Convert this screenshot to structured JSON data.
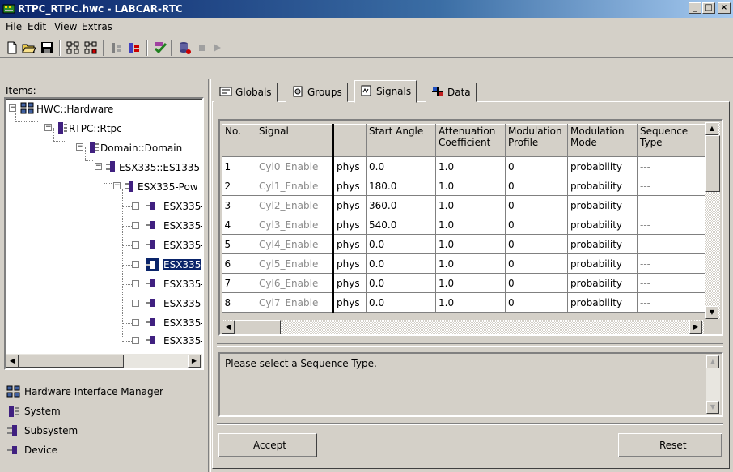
{
  "window": {
    "title": "RTPC_RTPC.hwc - LABCAR-RTC",
    "controls": [
      "_",
      "□",
      "×"
    ]
  },
  "menu": [
    {
      "label": "File"
    },
    {
      "label": "Edit"
    },
    {
      "label": "View"
    },
    {
      "label": "Extras"
    }
  ],
  "toolbar": {
    "icons": [
      "new-icon",
      "open-icon",
      "save-icon",
      "hardware-icon",
      "hardware-alt-icon",
      "config-icon",
      "config-alt-icon",
      "check-icon",
      "database-icon",
      "stop-icon",
      "play-icon"
    ]
  },
  "left": {
    "items_label": "Items:",
    "tree": [
      {
        "label": "HWC::Hardware",
        "level": 0,
        "expander": "−",
        "icon": "hardware"
      },
      {
        "label": "RTPC::Rtpc",
        "level": 1,
        "expander": "−",
        "icon": "system"
      },
      {
        "label": "Domain::Domain",
        "level": 2,
        "expander": "−",
        "icon": "system"
      },
      {
        "label": "ESX335::ES1335",
        "level": 3,
        "expander": "−",
        "icon": "subsystem"
      },
      {
        "label": "ESX335-Pow",
        "level": 4,
        "expander": "−",
        "icon": "subsystem"
      },
      {
        "label": "ESX335-",
        "level": 5,
        "expander": "",
        "icon": "device"
      },
      {
        "label": "ESX335-",
        "level": 5,
        "expander": "",
        "icon": "device"
      },
      {
        "label": "ESX335-",
        "level": 5,
        "expander": "",
        "icon": "device"
      },
      {
        "label": "ESX335",
        "level": 5,
        "expander": "",
        "icon": "device",
        "selected": true
      },
      {
        "label": "ESX335-",
        "level": 5,
        "expander": "",
        "icon": "device"
      },
      {
        "label": "ESX335-",
        "level": 5,
        "expander": "",
        "icon": "device"
      },
      {
        "label": "ESX335-",
        "level": 5,
        "expander": "",
        "icon": "device"
      },
      {
        "label": "ESX335-",
        "level": 5,
        "expander": "",
        "icon": "device"
      }
    ],
    "legend": [
      {
        "label": "Hardware Interface Manager",
        "icon": "hardware-icon"
      },
      {
        "label": "System",
        "icon": "system-icon"
      },
      {
        "label": "Subsystem",
        "icon": "subsystem-icon"
      },
      {
        "label": "Device",
        "icon": "device-icon"
      }
    ]
  },
  "tabs": [
    {
      "label": "Globals",
      "icon": "globals-icon"
    },
    {
      "label": "Groups",
      "icon": "groups-icon"
    },
    {
      "label": "Signals",
      "icon": "signals-icon",
      "active": true
    },
    {
      "label": "Data",
      "icon": "data-icon"
    }
  ],
  "grid": {
    "columns": [
      "No.",
      "Signal",
      "",
      "Start Angle",
      "Attenuation Coefficient",
      "Modulation Profile",
      "Modulation Mode",
      "Sequence Type"
    ],
    "rows": [
      [
        "1",
        "Cyl0_Enable",
        "phys",
        "0.0",
        "1.0",
        "0",
        "probability",
        "---"
      ],
      [
        "2",
        "Cyl1_Enable",
        "phys",
        "180.0",
        "1.0",
        "0",
        "probability",
        "---"
      ],
      [
        "3",
        "Cyl2_Enable",
        "phys",
        "360.0",
        "1.0",
        "0",
        "probability",
        "---"
      ],
      [
        "4",
        "Cyl3_Enable",
        "phys",
        "540.0",
        "1.0",
        "0",
        "probability",
        "---"
      ],
      [
        "5",
        "Cyl4_Enable",
        "phys",
        "0.0",
        "1.0",
        "0",
        "probability",
        "---"
      ],
      [
        "6",
        "Cyl5_Enable",
        "phys",
        "0.0",
        "1.0",
        "0",
        "probability",
        "---"
      ],
      [
        "7",
        "Cyl6_Enable",
        "phys",
        "0.0",
        "1.0",
        "0",
        "probability",
        "---"
      ],
      [
        "8",
        "Cyl7_Enable",
        "phys",
        "0.0",
        "1.0",
        "0",
        "probability",
        "---"
      ]
    ]
  },
  "message": "Please select a Sequence Type.",
  "buttons": {
    "accept": "Accept",
    "reset": "Reset"
  },
  "colors": {
    "titlebar": "#0a246a",
    "selection": "#0a246a",
    "face": "#d4d0c8"
  }
}
